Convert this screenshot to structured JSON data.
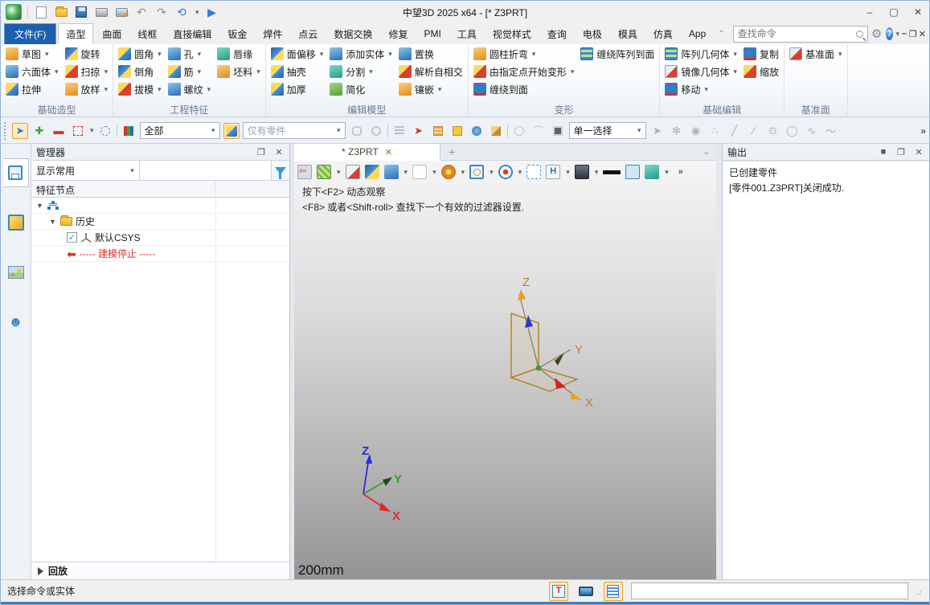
{
  "titlebar": {
    "title": "中望3D 2025 x64 - [*  Z3PRT]"
  },
  "menu": {
    "file": "文件(F)",
    "tabs": [
      "造型",
      "曲面",
      "线框",
      "直接编辑",
      "钣金",
      "焊件",
      "点云",
      "数据交换",
      "修复",
      "PMI",
      "工具",
      "视觉样式",
      "查询",
      "电极",
      "模具",
      "仿真",
      "App"
    ],
    "search_placeholder": "查找命令"
  },
  "ribbon": {
    "groups": [
      {
        "label": "基础造型",
        "cols": [
          [
            "草图",
            "六面体",
            "拉伸"
          ],
          [
            "旋转",
            "扫掠",
            "放样"
          ]
        ]
      },
      {
        "label": "工程特征",
        "cols": [
          [
            "圆角",
            "倒角",
            "拔模"
          ],
          [
            "孔",
            "筋",
            "螺纹"
          ],
          [
            "唇缘",
            "坯料"
          ]
        ]
      },
      {
        "label": "编辑模型",
        "cols": [
          [
            "面偏移",
            "抽壳",
            "加厚"
          ],
          [
            "添加实体",
            "分割",
            "简化"
          ],
          [
            "置换",
            "解析自相交",
            "镶嵌"
          ]
        ]
      },
      {
        "label": "变形",
        "cols": [
          [
            "圆柱折弯",
            "由指定点开始变形",
            "缠绕到面"
          ],
          [
            "缠绕阵列到面"
          ]
        ]
      },
      {
        "label": "基础编辑",
        "cols": [
          [
            "阵列几何体",
            "镜像几何体",
            "移动"
          ],
          [
            "复制",
            "缩放"
          ]
        ]
      },
      {
        "label": "基准面",
        "cols": [
          [
            "基准面"
          ]
        ]
      }
    ]
  },
  "quickbar": {
    "filter_scope": "全部",
    "entity_filter": "仅有零件",
    "selection_mode": "单一选择"
  },
  "manager": {
    "title": "管理器",
    "display_mode": "显示常用",
    "column_header": "特征节点",
    "history": "历史",
    "csys": "默认CSYS",
    "stop": "----- 建模停止 -----",
    "replay": "回放"
  },
  "document": {
    "tab_title": "*  Z3PRT",
    "hint_line1": "按下<F2> 动态观察",
    "hint_line2": "<F8> 或者<Shift-roll> 查找下一个有效的过滤器设置.",
    "scale_label": "200mm",
    "axes": {
      "x": "X",
      "y": "Y",
      "z": "Z"
    }
  },
  "output": {
    "title": "输出",
    "line1": "已创建零件",
    "line2": "[零件001.Z3PRT]关闭成功."
  },
  "statusbar": {
    "message": "选择命令或实体"
  }
}
